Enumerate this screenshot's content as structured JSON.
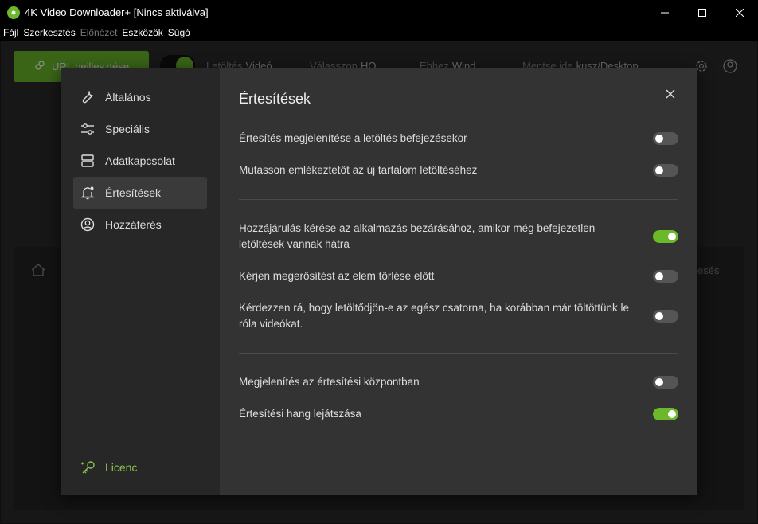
{
  "window": {
    "title": "4K Video Downloader+ [Nincs aktiválva]"
  },
  "menu": [
    "Fájl",
    "Szerkesztés",
    "Előnézet",
    "Eszközök",
    "Súgó"
  ],
  "toolbar": {
    "url_button": "URL beillesztése",
    "download_label": "Letöltés",
    "download_value": "Videó",
    "choose_label": "Válasszon",
    "choose_value": "HQ",
    "for_label": "Ehhez",
    "for_value": "Wind",
    "save_label": "Mentse ide",
    "save_value": "kusz/Desktop"
  },
  "background": {
    "right_text": "esés"
  },
  "dialog": {
    "title": "Értesítések",
    "sidebar": [
      {
        "label": "Általános",
        "icon": "wrench-icon"
      },
      {
        "label": "Speciális",
        "icon": "sliders-icon"
      },
      {
        "label": "Adatkapcsolat",
        "icon": "server-icon"
      },
      {
        "label": "Értesítések",
        "icon": "bell-icon"
      },
      {
        "label": "Hozzáférés",
        "icon": "user-circle-icon"
      }
    ],
    "licence": "Licenc",
    "settings": [
      {
        "label": "Értesítés megjelenítése a letöltés befejezésekor",
        "on": false
      },
      {
        "label": "Mutasson emlékeztetőt az új tartalom letöltéséhez",
        "on": false
      },
      {
        "label": "Hozzájárulás kérése az alkalmazás bezárásához, amikor még befejezetlen letöltések vannak hátra",
        "on": true
      },
      {
        "label": "Kérjen megerősítést az elem törlése előtt",
        "on": false
      },
      {
        "label": "Kérdezzen rá, hogy letöltődjön-e az egész csatorna, ha korábban már töltöttünk le róla videókat.",
        "on": false
      },
      {
        "label": "Megjelenítés az értesítési központban",
        "on": false
      },
      {
        "label": "Értesítési hang lejátszása",
        "on": true
      }
    ]
  },
  "colors": {
    "accent": "#6bb82b",
    "licence": "#8bc34a"
  }
}
